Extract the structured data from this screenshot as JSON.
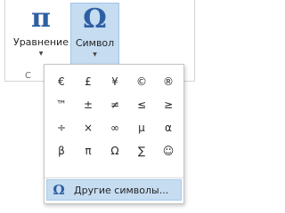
{
  "ribbon": {
    "equation": {
      "icon": "π",
      "label": "Уравнение",
      "caret": "▼"
    },
    "symbol": {
      "icon": "Ω",
      "label": "Символ",
      "caret": "▼"
    },
    "group_fragment": "С"
  },
  "symbols_dropdown": {
    "cells": [
      "€",
      "£",
      "¥",
      "©",
      "®",
      "™",
      "±",
      "≠",
      "≤",
      "≥",
      "÷",
      "×",
      "∞",
      "µ",
      "α",
      "β",
      "π",
      "Ω",
      "∑",
      "☺"
    ],
    "more": {
      "icon": "Ω",
      "label": "Другие символы..."
    }
  },
  "colors": {
    "accent": "#2e5fa3",
    "highlight": "#c5dcf1"
  }
}
